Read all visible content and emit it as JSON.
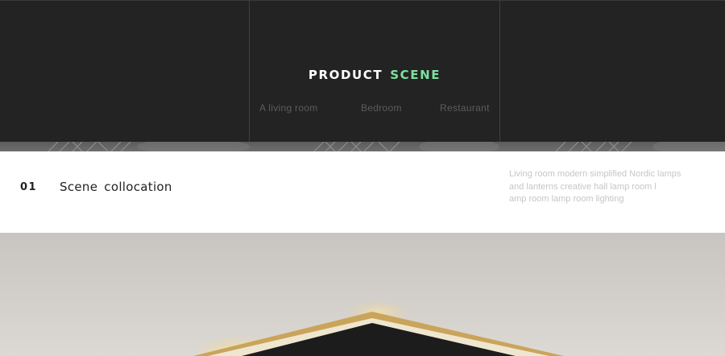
{
  "banner": {
    "title_primary": "PRODUCT",
    "title_accent": "SCENE",
    "accent_color": "#7fe0a0",
    "tabs": [
      "A living room",
      "Bedroom",
      "Restaurant"
    ]
  },
  "section": {
    "number": "01",
    "heading": "Scene collocation",
    "description_lines": [
      "Living room modern simplified Nordic lamps",
      "and lanterns creative hall lamp room l",
      "amp room lamp room lighting"
    ]
  }
}
